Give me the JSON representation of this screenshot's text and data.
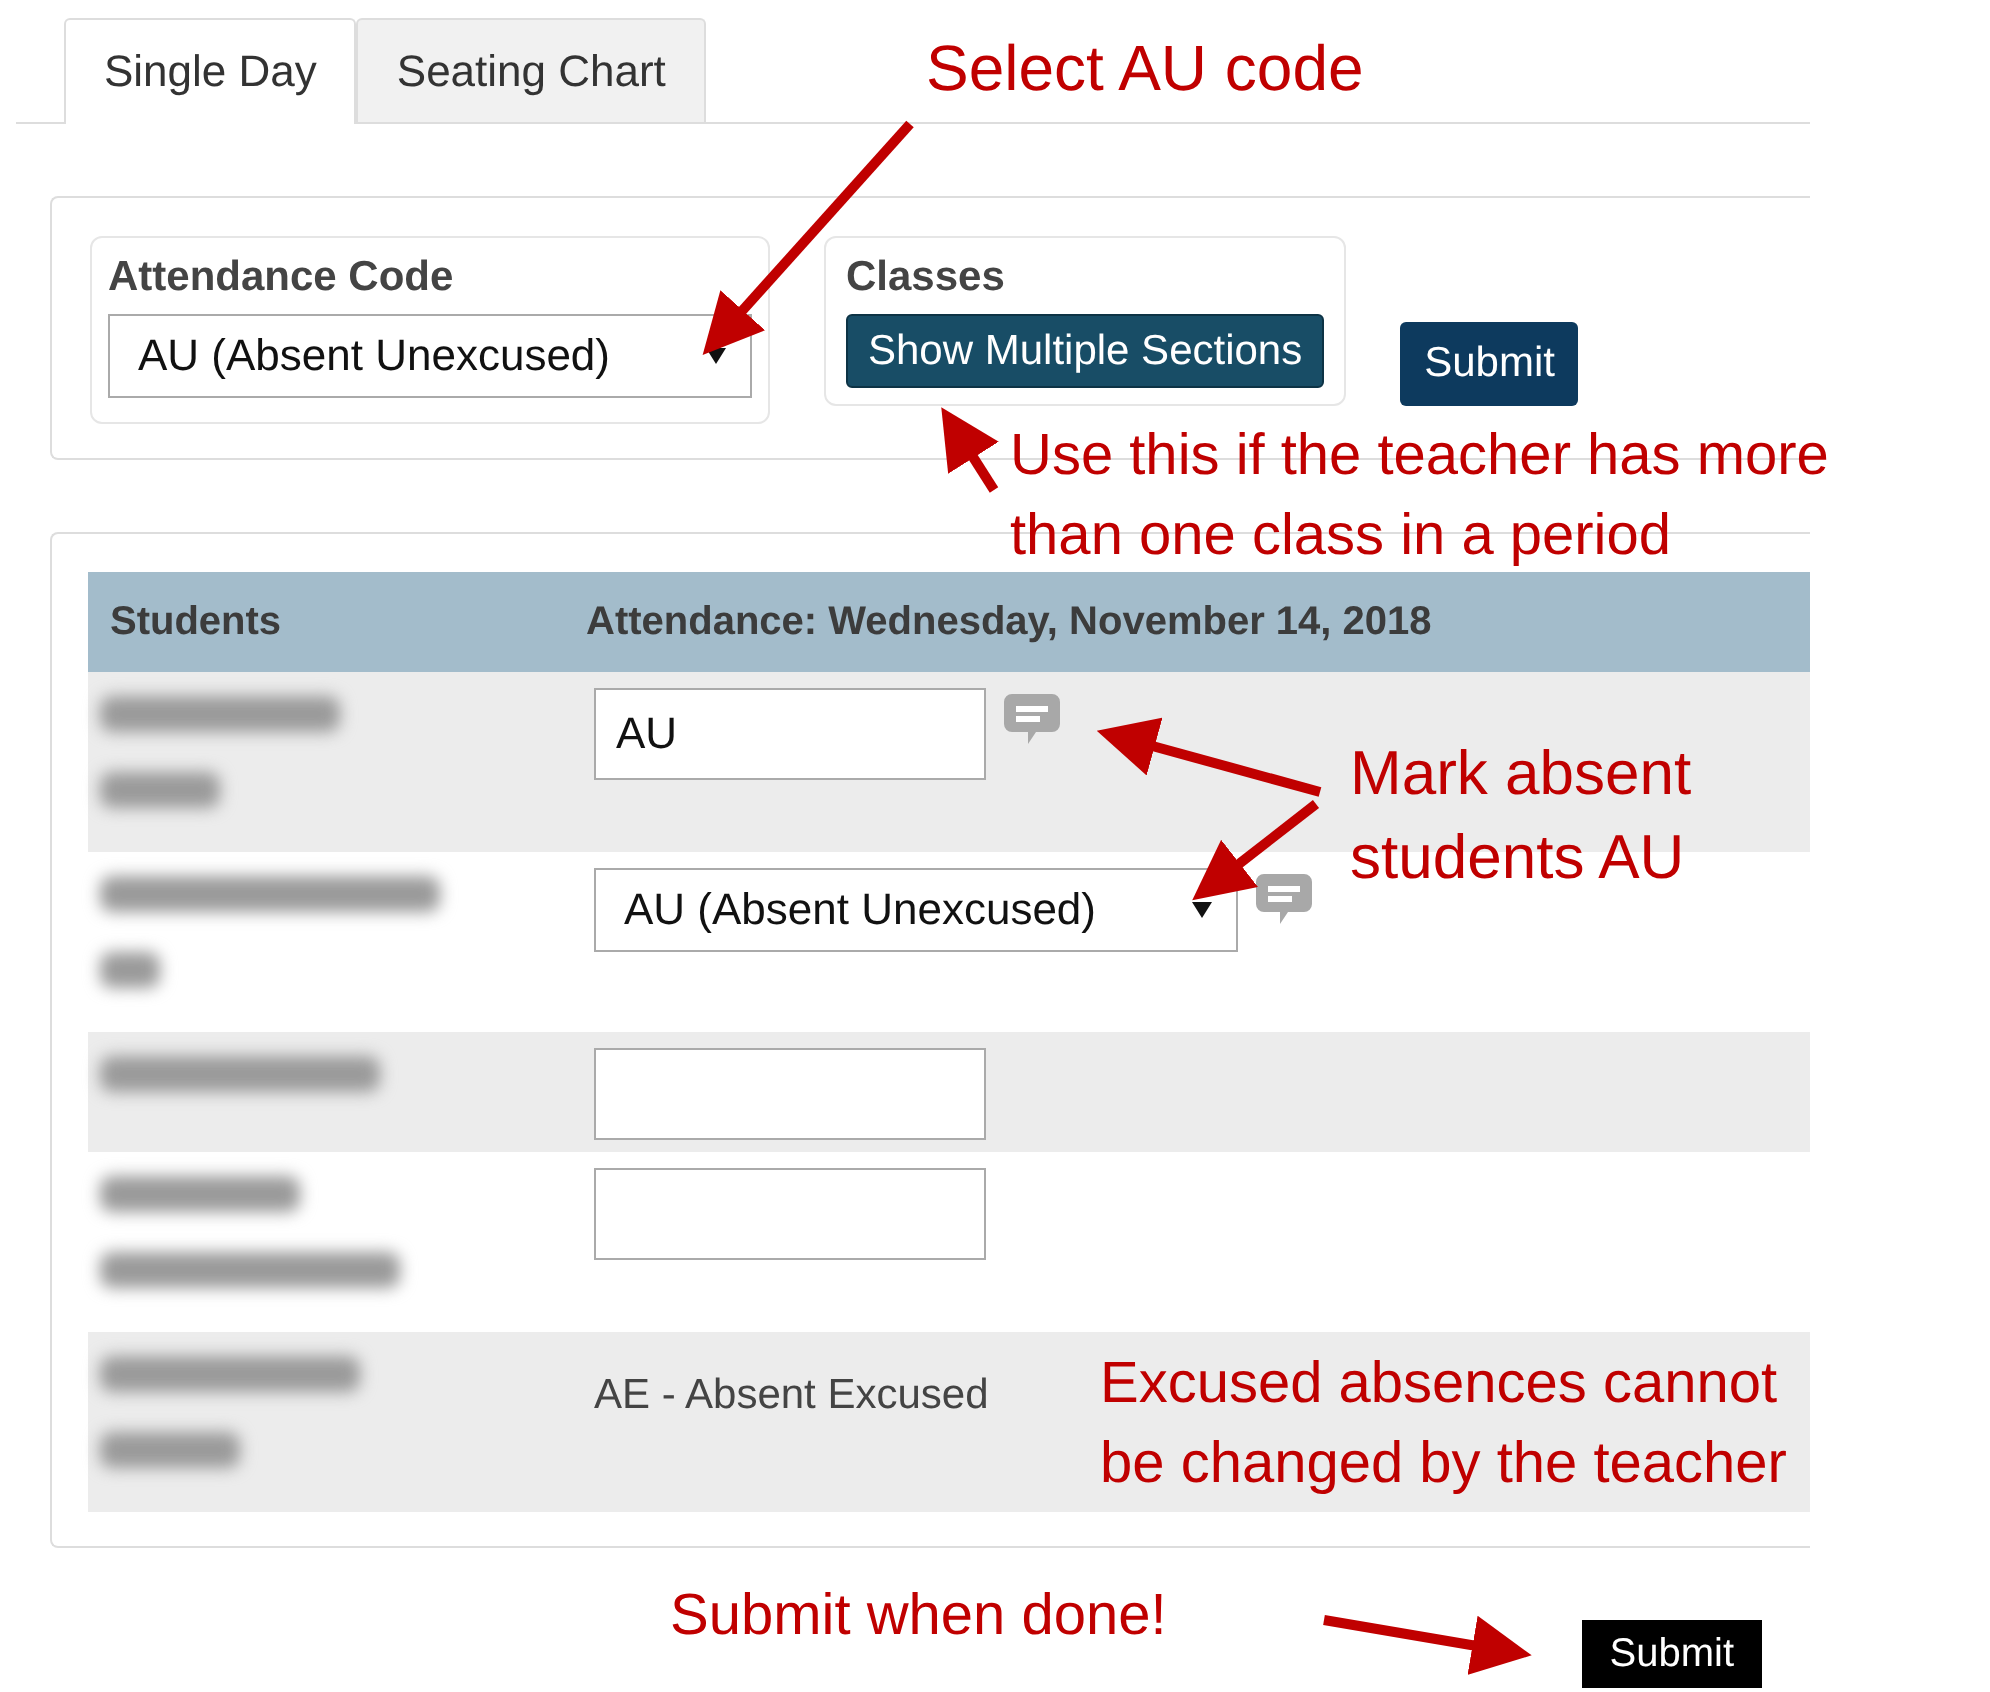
{
  "tabs": [
    {
      "label": "Single Day",
      "selected": true
    },
    {
      "label": "Seating Chart",
      "selected": false
    }
  ],
  "filters": {
    "attendance_code": {
      "label": "Attendance Code",
      "value": "AU (Absent Unexcused)"
    },
    "classes": {
      "label": "Classes",
      "button": "Show Multiple Sections"
    },
    "submit": "Submit"
  },
  "table": {
    "columns": [
      "Students",
      "Attendance: Wednesday, November 14, 2018"
    ],
    "rows": [
      {
        "kind": "input",
        "value": "AU",
        "comment": true
      },
      {
        "kind": "select",
        "value": "AU (Absent Unexcused)",
        "comment": true
      },
      {
        "kind": "input",
        "comment": false
      },
      {
        "kind": "input",
        "comment": false
      },
      {
        "kind": "text",
        "value": "AE - Absent Excused",
        "comment": false
      }
    ]
  },
  "submit": "Submit",
  "annotations": [
    "Select AU code",
    "Use this if the teacher has more\nthan one class in a period",
    "Mark absent\nstudents AU",
    "Excused absences cannot\nbe changed by the teacher",
    "Submit when done!"
  ]
}
